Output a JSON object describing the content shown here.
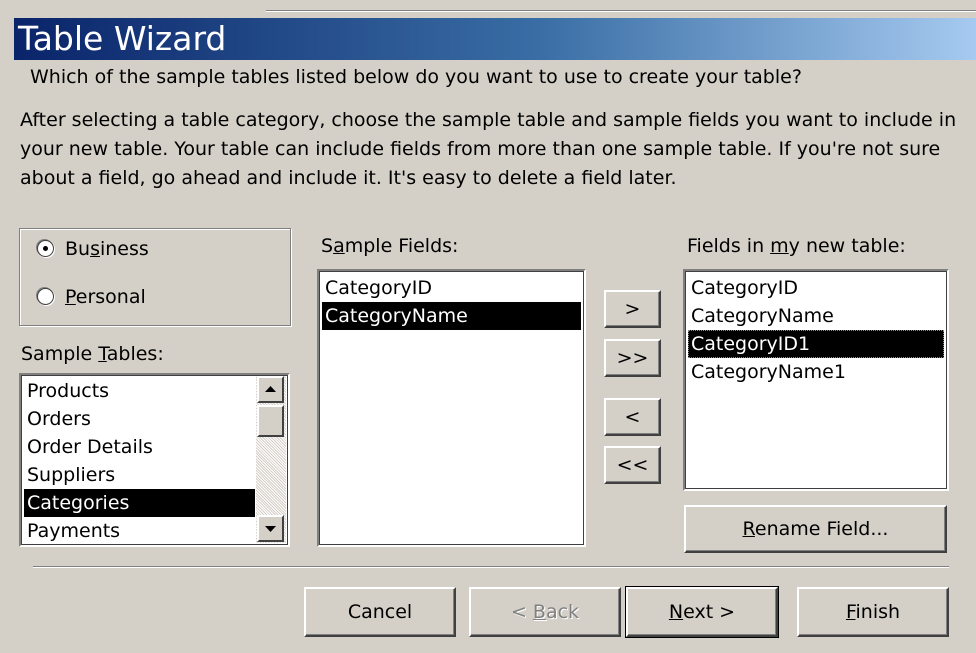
{
  "window": {
    "title": "Table Wizard"
  },
  "instructions": {
    "question": "Which of the sample tables listed below do you want to use to create your table?",
    "paragraph": "After selecting a table category, choose the sample table and sample fields you want to include in your new table. Your table can include fields from more than one sample table. If you're not sure about a field, go ahead and include it. It's easy to delete a field later."
  },
  "category": {
    "options": [
      {
        "label": "Business",
        "selected": true
      },
      {
        "label": "Personal",
        "selected": false
      }
    ]
  },
  "sample_tables": {
    "label": "Sample Tables:",
    "items": [
      "Products",
      "Orders",
      "Order Details",
      "Suppliers",
      "Categories",
      "Payments"
    ],
    "selected": "Categories"
  },
  "sample_fields": {
    "label": "Sample Fields:",
    "items": [
      "CategoryID",
      "CategoryName"
    ],
    "selected": "CategoryName"
  },
  "new_table_fields": {
    "label": "Fields in my new table:",
    "items": [
      "CategoryID",
      "CategoryName",
      "CategoryID1",
      "CategoryName1"
    ],
    "selected": "CategoryID1"
  },
  "move_buttons": {
    "add_one": ">",
    "add_all": ">>",
    "remove_one": "<",
    "remove_all": "<<"
  },
  "rename_button": "Rename Field...",
  "footer": {
    "cancel": "Cancel",
    "back": "< Back",
    "next": "Next >",
    "finish": "Finish"
  }
}
